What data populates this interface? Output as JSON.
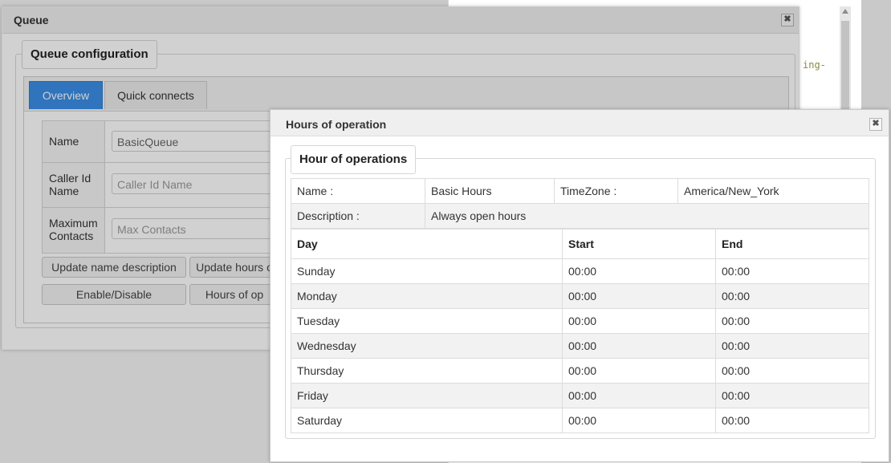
{
  "background": {
    "code_snippet": "ing-"
  },
  "queue_dialog": {
    "title": "Queue",
    "close_glyph": "✖",
    "section_title": "Queue configuration",
    "tabs": [
      {
        "label": "Overview",
        "active": true
      },
      {
        "label": "Quick connects",
        "active": false
      }
    ],
    "fields": [
      {
        "label_lines": [
          "Name"
        ],
        "value": "BasicQueue",
        "placeholder": ""
      },
      {
        "label_lines": [
          "Caller Id",
          "Name"
        ],
        "value": "",
        "placeholder": "Caller Id Name"
      },
      {
        "label_lines": [
          "Maximum",
          "Contacts"
        ],
        "value": "",
        "placeholder": "Max Contacts"
      }
    ],
    "buttons": [
      "Update name description",
      "Update hours o",
      "Enable/Disable",
      "Hours of op"
    ]
  },
  "hours_dialog": {
    "title": "Hours of operation",
    "close_glyph": "✖",
    "section_title": "Hour of operations",
    "info": {
      "name_label": "Name :",
      "name_value": "Basic Hours",
      "timezone_label": "TimeZone :",
      "timezone_value": "America/New_York",
      "description_label": "Description :",
      "description_value": "Always open hours"
    },
    "columns": [
      "Day",
      "Start",
      "End"
    ],
    "rows": [
      {
        "day": "Sunday",
        "start": "00:00",
        "end": "00:00"
      },
      {
        "day": "Monday",
        "start": "00:00",
        "end": "00:00"
      },
      {
        "day": "Tuesday",
        "start": "00:00",
        "end": "00:00"
      },
      {
        "day": "Wednesday",
        "start": "00:00",
        "end": "00:00"
      },
      {
        "day": "Thursday",
        "start": "00:00",
        "end": "00:00"
      },
      {
        "day": "Friday",
        "start": "00:00",
        "end": "00:00"
      },
      {
        "day": "Saturday",
        "start": "00:00",
        "end": "00:00"
      }
    ]
  },
  "colors": {
    "active_tab": "#3a8ee6",
    "backdrop": "#c9c9c9",
    "stripe": "#f2f2f2"
  }
}
